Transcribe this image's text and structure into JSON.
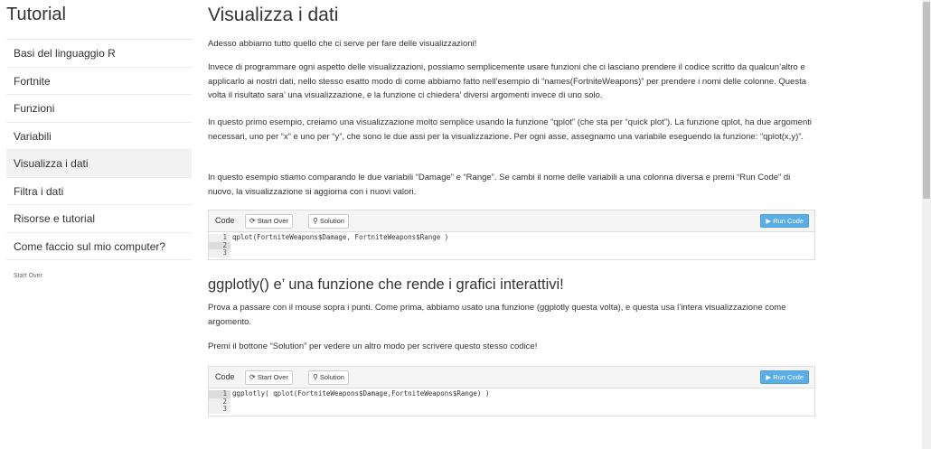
{
  "sidebar": {
    "title": "Tutorial",
    "items": [
      {
        "label": "Basi del linguaggio R",
        "active": false
      },
      {
        "label": "Fortnite",
        "active": false
      },
      {
        "label": "Funzioni",
        "active": false
      },
      {
        "label": "Variabili",
        "active": false
      },
      {
        "label": "Visualizza i dati",
        "active": true
      },
      {
        "label": "Filtra i dati",
        "active": false
      },
      {
        "label": "Risorse e tutorial",
        "active": false
      },
      {
        "label": "Come faccio sul mio computer?",
        "active": false
      }
    ],
    "start_over": "Start Over"
  },
  "main": {
    "title": "Visualizza i dati",
    "paragraphs": [
      "Adesso abbiamo tutto quello che ci serve per fare delle visualizzazioni!",
      "Invece di programmare ogni aspetto delle visualizzazioni, possiamo semplicemente usare funzioni che ci lasciano prendere il codice scritto da qualcun’altro e applicarlo ai nostri dati, nello stesso esatto modo di come abbiamo fatto nell’esempio di “names(FortniteWeapons)” per prendere i nomi delle colonne. Questa volta il risultato sara’ una visualizzazione, e la funzione ci chiedera’ diversi argomenti invece di uno solo.",
      "In questo primo esempio, creiamo una visualizzazione molto semplice usando la funzione “qplot” (che sta per “quick plot”). La funzione qplot, ha due argomenti necessari, uno per “x” e uno per “y”, che sono le due assi per la visualizzazione. Per ogni asse, assegnamo una variabile eseguendo la funzione: “qplot(x,y)”.",
      "In questo esempio stiamo comparando le due variabili “Damage” e “Range”. Se cambi il nome delle variabili a una colonna diversa e premi “Run Code” di nuovo, la visualizzazione si aggiorna con i nuovi valori."
    ],
    "code1": {
      "label": "Code",
      "start_over": "Start Over",
      "solution": "Solution",
      "run": "Run Code",
      "lines": [
        {
          "n": "1",
          "text": "qplot(FortniteWeapons$Damage, FortniteWeapons$Range )"
        },
        {
          "n": "2",
          "text": ""
        },
        {
          "n": "3",
          "text": ""
        }
      ]
    },
    "section2": {
      "title": "ggplotly() e’ una funzione che rende i grafici interattivi!",
      "paragraphs": [
        "Prova a passare con il mouse sopra i punti. Come prima, abbiamo usato una funzione (ggplotly questa volta), e questa usa l’intera visualizzazione come argomento.",
        "Premi il bottone “Solution” per vedere un altro modo per scrivere questo stesso codice!"
      ]
    },
    "code2": {
      "label": "Code",
      "start_over": "Start Over",
      "solution": "Solution",
      "run": "Run Code",
      "lines": [
        {
          "n": "1",
          "text": "ggplotly( qplot(FortniteWeapons$Damage,FortniteWeapons$Range) )"
        },
        {
          "n": "2",
          "text": ""
        },
        {
          "n": "3",
          "text": ""
        }
      ]
    }
  },
  "colors": {
    "run_button": "#5bade6",
    "active_nav": "#f2f2f2",
    "text": "#333333"
  },
  "icons": {
    "start_over": "refresh-icon",
    "solution": "lightbulb-icon",
    "run": "play-icon"
  }
}
